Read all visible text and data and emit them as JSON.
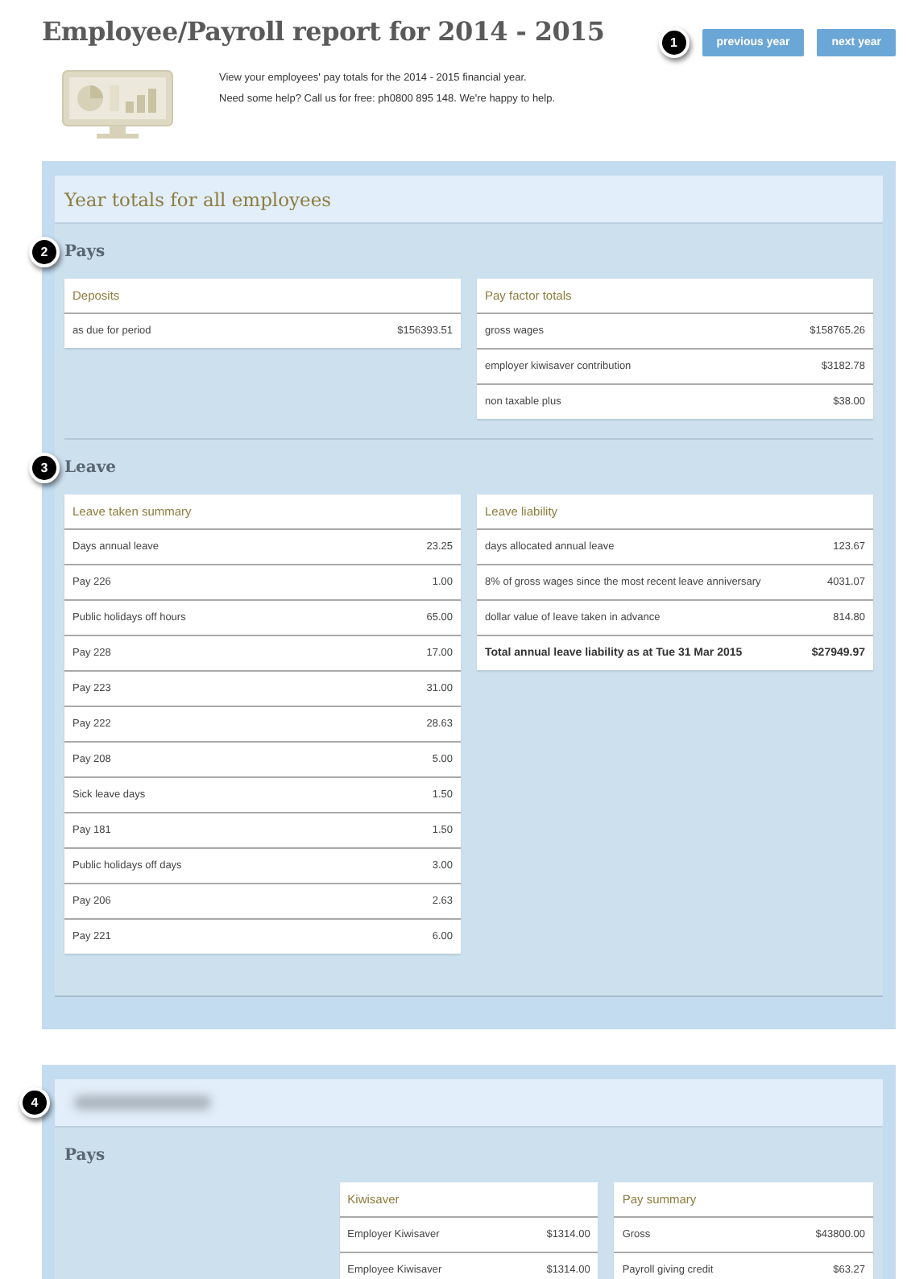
{
  "header": {
    "title": "Employee/Payroll report for 2014 - 2015",
    "callout": "1",
    "buttons": [
      "previous year",
      "next year"
    ],
    "intro": [
      "View your employees' pay totals for the 2014 - 2015 financial year.",
      "Need some help? Call us for free: ph0800 895 148. We're happy to help."
    ]
  },
  "sections": [
    {
      "title": "Year totals for all employees",
      "title_blurred": false,
      "groups": [
        {
          "heading": "Pays",
          "callout": "2",
          "tables": [
            {
              "title": "Deposits",
              "rows": [
                {
                  "label": "as due for period",
                  "value": "$156393.51"
                }
              ]
            },
            {
              "title": "Pay factor totals",
              "rows": [
                {
                  "label": "gross wages",
                  "value": "$158765.26"
                },
                {
                  "label": "employer kiwisaver contribution",
                  "value": "$3182.78"
                },
                {
                  "label": "non taxable plus",
                  "value": "$38.00"
                }
              ]
            }
          ]
        },
        {
          "heading": "Leave",
          "callout": "3",
          "tables": [
            {
              "title": "Leave taken summary",
              "rows": [
                {
                  "label": "Days annual leave",
                  "value": "23.25"
                },
                {
                  "label": "Pay 226",
                  "value": "1.00"
                },
                {
                  "label": "Public holidays off hours",
                  "value": "65.00"
                },
                {
                  "label": "Pay 228",
                  "value": "17.00"
                },
                {
                  "label": "Pay 223",
                  "value": "31.00"
                },
                {
                  "label": "Pay 222",
                  "value": "28.63"
                },
                {
                  "label": "Pay 208",
                  "value": "5.00"
                },
                {
                  "label": "Sick leave days",
                  "value": "1.50"
                },
                {
                  "label": "Pay 181",
                  "value": "1.50"
                },
                {
                  "label": "Public holidays off days",
                  "value": "3.00"
                },
                {
                  "label": "Pay 206",
                  "value": "2.63"
                },
                {
                  "label": "Pay 221",
                  "value": "6.00"
                }
              ]
            },
            {
              "title": "Leave liability",
              "rows": [
                {
                  "label": "days allocated annual leave",
                  "value": "123.67"
                },
                {
                  "label": "8% of gross wages since the most recent leave anniversary",
                  "value": "4031.07"
                },
                {
                  "label": "dollar value of leave taken in advance",
                  "value": "814.80"
                }
              ],
              "total": {
                "label": "Total annual leave liability as at Tue 31 Mar 2015",
                "value": "$27949.97"
              }
            }
          ]
        }
      ]
    },
    {
      "callout": "4",
      "title_blurred": true,
      "groups": [
        {
          "heading": "Pays",
          "tables": [
            {
              "title": "Kiwisaver",
              "rows": [
                {
                  "label": "Employer Kiwisaver",
                  "value": "$1314.00"
                },
                {
                  "label": "Employee Kiwisaver",
                  "value": "$1314.00"
                }
              ]
            },
            {
              "title": "Pay summary",
              "rows": [
                {
                  "label": "Gross",
                  "value": "$43800.00"
                },
                {
                  "label": "Payroll giving credit",
                  "value": "$63.27"
                }
              ]
            }
          ]
        }
      ]
    }
  ]
}
